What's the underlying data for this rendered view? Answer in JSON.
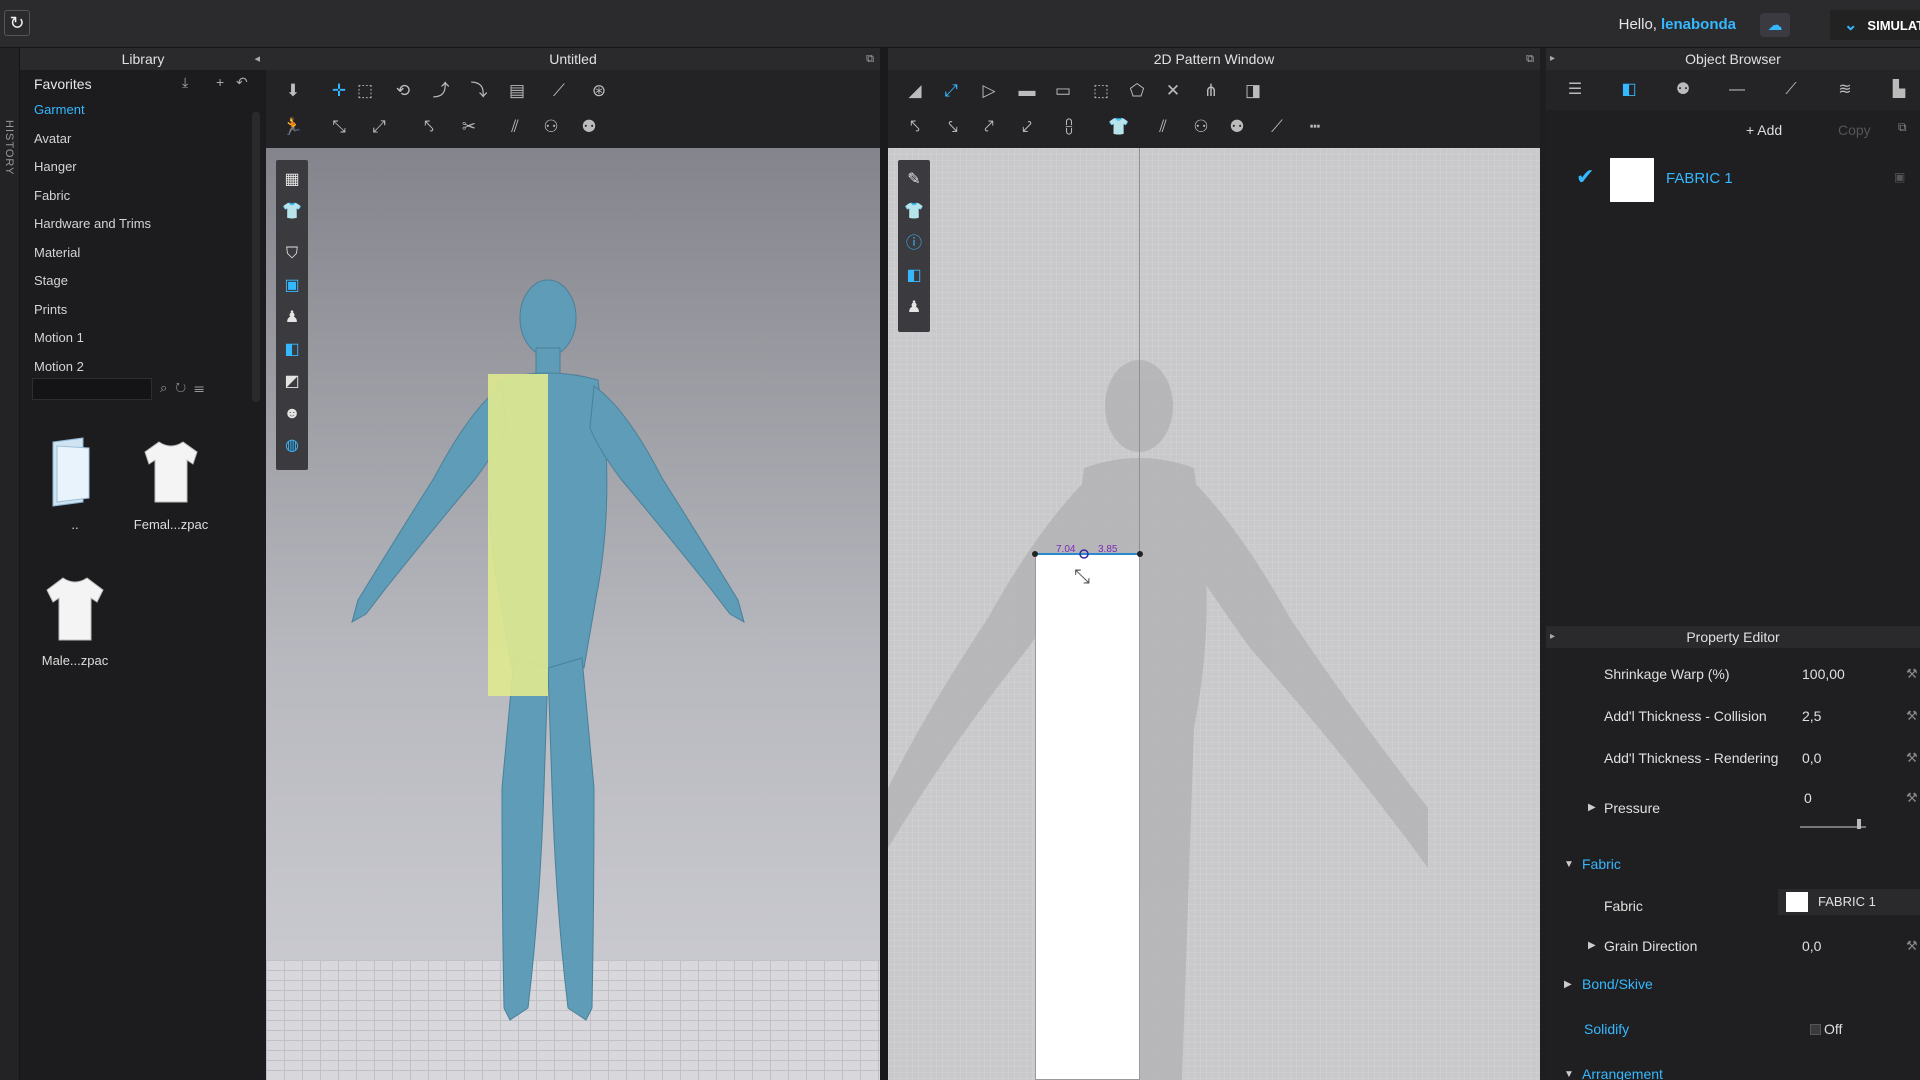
{
  "topbar": {
    "greeting": "Hello,",
    "username": "lenabonda",
    "simulation_label": "SIMULAT"
  },
  "history_label": "HISTORY",
  "library": {
    "title": "Library",
    "favorites": "Favorites",
    "items": [
      {
        "label": "Garment",
        "active": true
      },
      {
        "label": "Avatar"
      },
      {
        "label": "Hanger"
      },
      {
        "label": "Fabric"
      },
      {
        "label": "Hardware and Trims"
      },
      {
        "label": "Material"
      },
      {
        "label": "Stage"
      },
      {
        "label": "Prints"
      },
      {
        "label": "Motion 1"
      },
      {
        "label": "Motion 2"
      }
    ],
    "files": [
      {
        "label": ".."
      },
      {
        "label": "Femal...zpac"
      },
      {
        "label": "Male...zpac"
      }
    ]
  },
  "view3d": {
    "title": "Untitled"
  },
  "view2d": {
    "title": "2D Pattern Window",
    "measure_left": "7.04",
    "measure_right": "3.85"
  },
  "object_browser": {
    "title": "Object Browser",
    "add_label": "+ Add",
    "copy_label": "Copy",
    "fabric_name": "FABRIC 1"
  },
  "property_editor": {
    "title": "Property Editor",
    "rows": {
      "shrinkage_warp": {
        "label": "Shrinkage Warp (%)",
        "value": "100,00"
      },
      "thickness_collision": {
        "label": "Add'l Thickness - Collision",
        "value": "2,5"
      },
      "thickness_rendering": {
        "label": "Add'l Thickness - Rendering",
        "value": "0,0"
      },
      "pressure": {
        "label": "Pressure",
        "value": "0"
      },
      "fabric_section": "Fabric",
      "fabric": {
        "label": "Fabric",
        "value": "FABRIC 1"
      },
      "grain_direction": {
        "label": "Grain Direction",
        "value": "0,0"
      },
      "bond_skive": "Bond/Skive",
      "solidify": {
        "label": "Solidify",
        "value": "Off"
      },
      "arrangement": "Arrangement"
    }
  },
  "colors": {
    "accent": "#35b8ff",
    "avatar": "#5f9cb8",
    "pattern_3d": "#dde88f",
    "pattern_2d": "#ffffff"
  }
}
